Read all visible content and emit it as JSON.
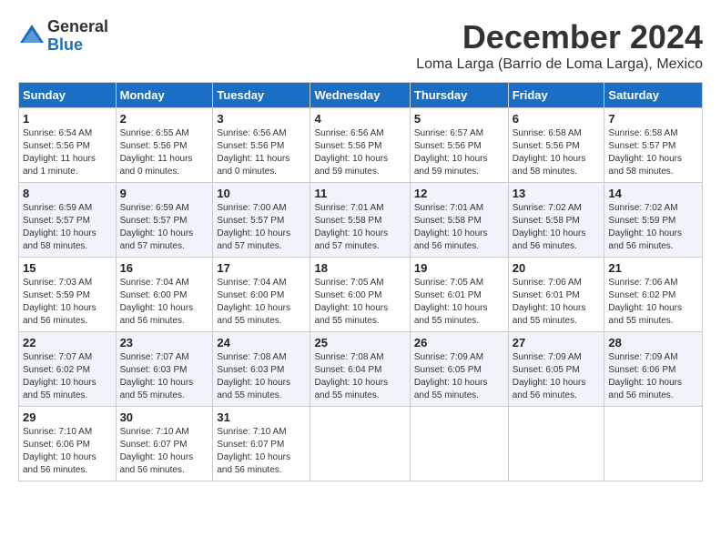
{
  "logo": {
    "general": "General",
    "blue": "Blue"
  },
  "title": "December 2024",
  "location": "Loma Larga (Barrio de Loma Larga), Mexico",
  "days_of_week": [
    "Sunday",
    "Monday",
    "Tuesday",
    "Wednesday",
    "Thursday",
    "Friday",
    "Saturday"
  ],
  "weeks": [
    [
      {
        "day": "1",
        "info": "Sunrise: 6:54 AM\nSunset: 5:56 PM\nDaylight: 11 hours\nand 1 minute."
      },
      {
        "day": "2",
        "info": "Sunrise: 6:55 AM\nSunset: 5:56 PM\nDaylight: 11 hours\nand 0 minutes."
      },
      {
        "day": "3",
        "info": "Sunrise: 6:56 AM\nSunset: 5:56 PM\nDaylight: 11 hours\nand 0 minutes."
      },
      {
        "day": "4",
        "info": "Sunrise: 6:56 AM\nSunset: 5:56 PM\nDaylight: 10 hours\nand 59 minutes."
      },
      {
        "day": "5",
        "info": "Sunrise: 6:57 AM\nSunset: 5:56 PM\nDaylight: 10 hours\nand 59 minutes."
      },
      {
        "day": "6",
        "info": "Sunrise: 6:58 AM\nSunset: 5:56 PM\nDaylight: 10 hours\nand 58 minutes."
      },
      {
        "day": "7",
        "info": "Sunrise: 6:58 AM\nSunset: 5:57 PM\nDaylight: 10 hours\nand 58 minutes."
      }
    ],
    [
      {
        "day": "8",
        "info": "Sunrise: 6:59 AM\nSunset: 5:57 PM\nDaylight: 10 hours\nand 58 minutes."
      },
      {
        "day": "9",
        "info": "Sunrise: 6:59 AM\nSunset: 5:57 PM\nDaylight: 10 hours\nand 57 minutes."
      },
      {
        "day": "10",
        "info": "Sunrise: 7:00 AM\nSunset: 5:57 PM\nDaylight: 10 hours\nand 57 minutes."
      },
      {
        "day": "11",
        "info": "Sunrise: 7:01 AM\nSunset: 5:58 PM\nDaylight: 10 hours\nand 57 minutes."
      },
      {
        "day": "12",
        "info": "Sunrise: 7:01 AM\nSunset: 5:58 PM\nDaylight: 10 hours\nand 56 minutes."
      },
      {
        "day": "13",
        "info": "Sunrise: 7:02 AM\nSunset: 5:58 PM\nDaylight: 10 hours\nand 56 minutes."
      },
      {
        "day": "14",
        "info": "Sunrise: 7:02 AM\nSunset: 5:59 PM\nDaylight: 10 hours\nand 56 minutes."
      }
    ],
    [
      {
        "day": "15",
        "info": "Sunrise: 7:03 AM\nSunset: 5:59 PM\nDaylight: 10 hours\nand 56 minutes."
      },
      {
        "day": "16",
        "info": "Sunrise: 7:04 AM\nSunset: 6:00 PM\nDaylight: 10 hours\nand 56 minutes."
      },
      {
        "day": "17",
        "info": "Sunrise: 7:04 AM\nSunset: 6:00 PM\nDaylight: 10 hours\nand 55 minutes."
      },
      {
        "day": "18",
        "info": "Sunrise: 7:05 AM\nSunset: 6:00 PM\nDaylight: 10 hours\nand 55 minutes."
      },
      {
        "day": "19",
        "info": "Sunrise: 7:05 AM\nSunset: 6:01 PM\nDaylight: 10 hours\nand 55 minutes."
      },
      {
        "day": "20",
        "info": "Sunrise: 7:06 AM\nSunset: 6:01 PM\nDaylight: 10 hours\nand 55 minutes."
      },
      {
        "day": "21",
        "info": "Sunrise: 7:06 AM\nSunset: 6:02 PM\nDaylight: 10 hours\nand 55 minutes."
      }
    ],
    [
      {
        "day": "22",
        "info": "Sunrise: 7:07 AM\nSunset: 6:02 PM\nDaylight: 10 hours\nand 55 minutes."
      },
      {
        "day": "23",
        "info": "Sunrise: 7:07 AM\nSunset: 6:03 PM\nDaylight: 10 hours\nand 55 minutes."
      },
      {
        "day": "24",
        "info": "Sunrise: 7:08 AM\nSunset: 6:03 PM\nDaylight: 10 hours\nand 55 minutes."
      },
      {
        "day": "25",
        "info": "Sunrise: 7:08 AM\nSunset: 6:04 PM\nDaylight: 10 hours\nand 55 minutes."
      },
      {
        "day": "26",
        "info": "Sunrise: 7:09 AM\nSunset: 6:05 PM\nDaylight: 10 hours\nand 55 minutes."
      },
      {
        "day": "27",
        "info": "Sunrise: 7:09 AM\nSunset: 6:05 PM\nDaylight: 10 hours\nand 56 minutes."
      },
      {
        "day": "28",
        "info": "Sunrise: 7:09 AM\nSunset: 6:06 PM\nDaylight: 10 hours\nand 56 minutes."
      }
    ],
    [
      {
        "day": "29",
        "info": "Sunrise: 7:10 AM\nSunset: 6:06 PM\nDaylight: 10 hours\nand 56 minutes."
      },
      {
        "day": "30",
        "info": "Sunrise: 7:10 AM\nSunset: 6:07 PM\nDaylight: 10 hours\nand 56 minutes."
      },
      {
        "day": "31",
        "info": "Sunrise: 7:10 AM\nSunset: 6:07 PM\nDaylight: 10 hours\nand 56 minutes."
      },
      {
        "day": "",
        "info": ""
      },
      {
        "day": "",
        "info": ""
      },
      {
        "day": "",
        "info": ""
      },
      {
        "day": "",
        "info": ""
      }
    ]
  ]
}
